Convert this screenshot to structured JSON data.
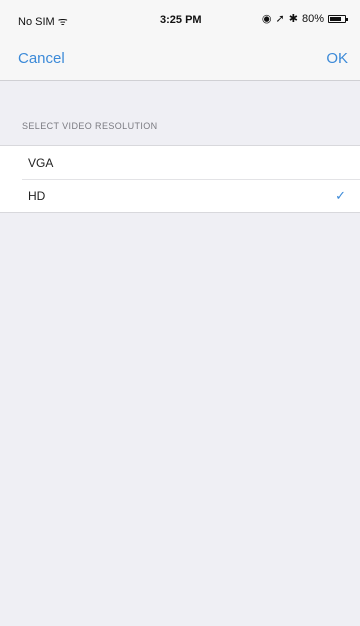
{
  "status_bar": {
    "carrier": "No SIM",
    "time": "3:25 PM",
    "battery": "80%",
    "battery_level": 0.8,
    "icons": [
      "wifi-icon",
      "lock-rotation-icon",
      "location-icon",
      "bluetooth-icon",
      "battery-icon"
    ]
  },
  "nav": {
    "cancel_label": "Cancel",
    "ok_label": "OK"
  },
  "section": {
    "header": "SELECT VIDEO RESOLUTION"
  },
  "options": [
    {
      "label": "VGA",
      "selected": false
    },
    {
      "label": "HD",
      "selected": true
    }
  ],
  "colors": {
    "accent": "#3c8ad8",
    "background": "#efeff4",
    "bar": "#f7f7f7"
  }
}
